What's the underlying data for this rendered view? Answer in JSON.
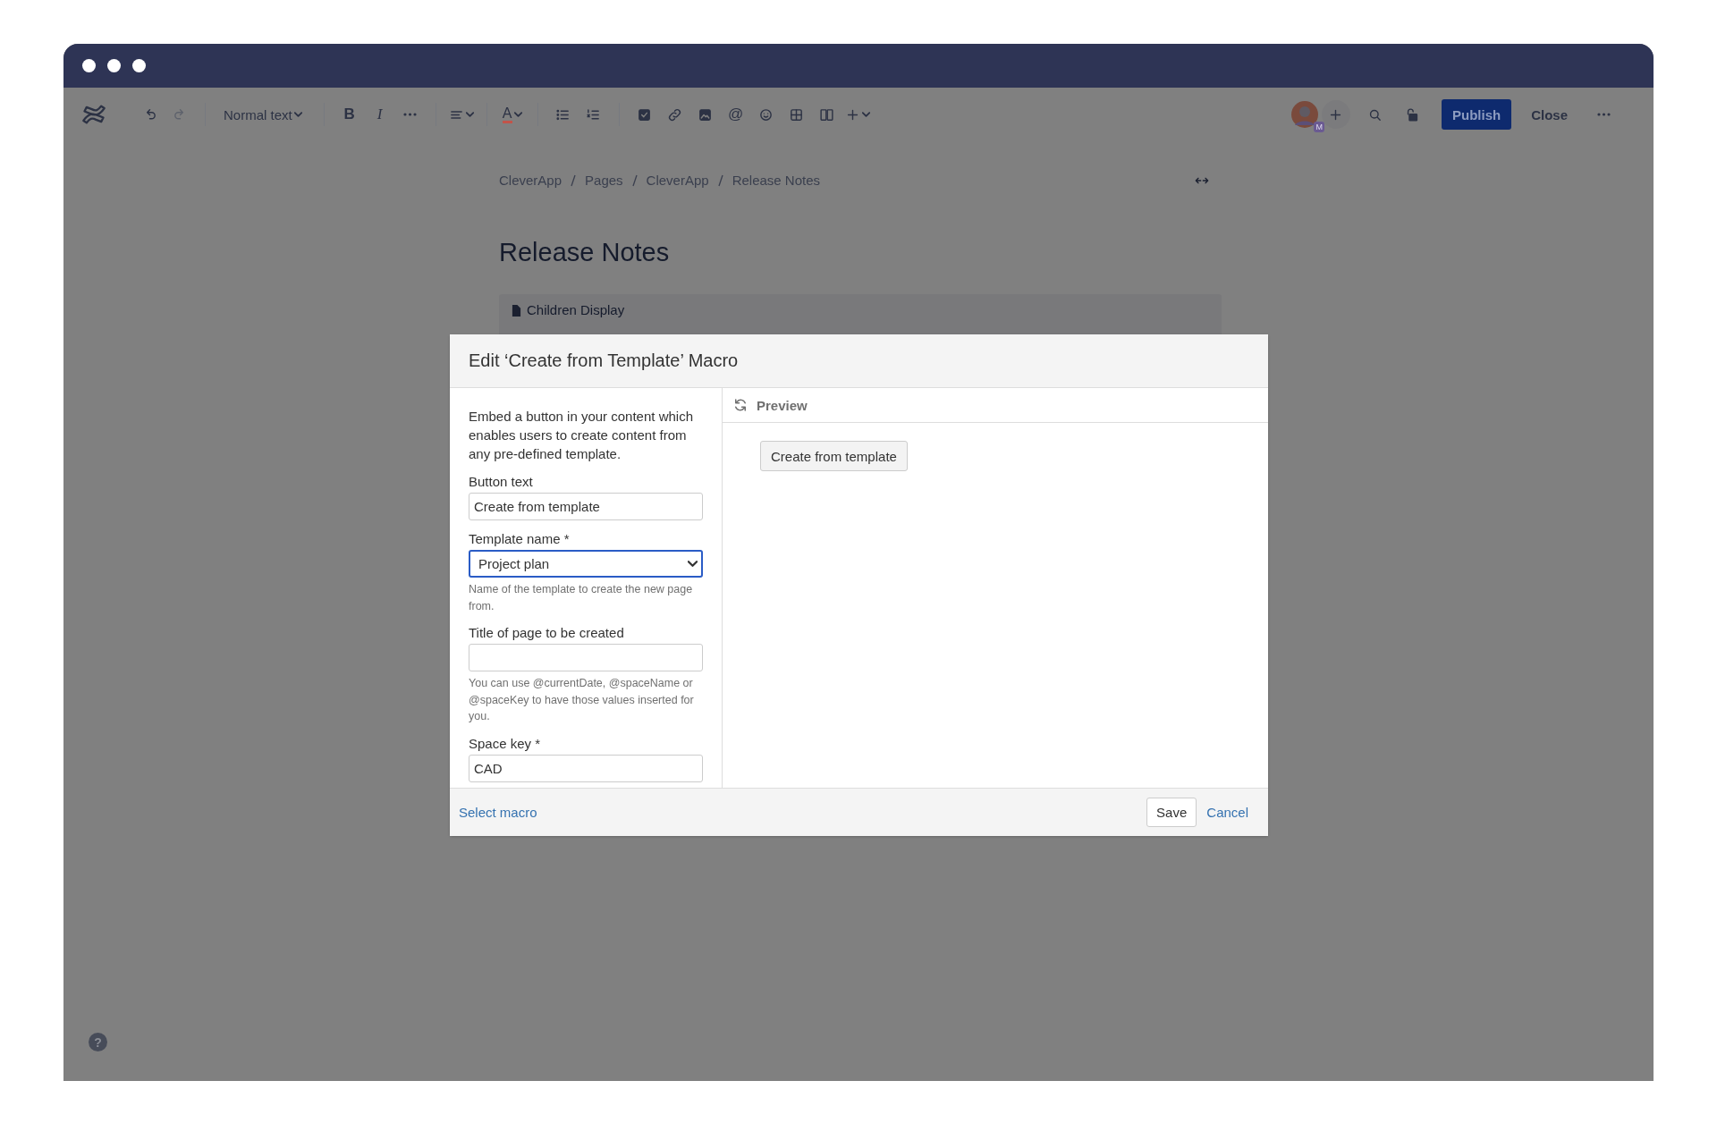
{
  "toolbar": {
    "left": [
      [
        {
          "kind": "logo"
        }
      ],
      [
        {
          "kind": "undo",
          "disabled": false
        },
        {
          "kind": "redo",
          "disabled": true
        }
      ],
      [
        {
          "kind": "dropdown",
          "text": "Normal text"
        }
      ],
      [
        {
          "kind": "bold",
          "text": "B"
        },
        {
          "kind": "italic",
          "text": "I"
        },
        {
          "kind": "more"
        }
      ],
      [
        {
          "kind": "align",
          "menu": true
        }
      ],
      [
        {
          "kind": "color",
          "text": "A",
          "menu": true
        }
      ],
      [
        {
          "kind": "bullets"
        },
        {
          "kind": "numbers"
        }
      ],
      [
        {
          "kind": "task"
        },
        {
          "kind": "link"
        },
        {
          "kind": "image"
        },
        {
          "kind": "glyph",
          "text": "@"
        },
        {
          "kind": "emoji"
        },
        {
          "kind": "table"
        },
        {
          "kind": "layout"
        },
        {
          "kind": "insert",
          "menu": true
        }
      ]
    ],
    "avatar_badge": "M",
    "publish": "Publish",
    "close": "Close"
  },
  "breadcrumbs": [
    "CleverApp",
    "Pages",
    "CleverApp",
    "Release Notes"
  ],
  "page_title": "Release Notes",
  "macro": {
    "name": "Children Display"
  },
  "dialog": {
    "title": "Edit ‘Create from Template’ Macro",
    "description": "Embed a button in your content which enables users to create content from any pre-defined template.",
    "fields": [
      {
        "kind": "text",
        "label": "Button text",
        "value": "Create from template"
      },
      {
        "kind": "select",
        "label": "Template name *",
        "value": "Project plan",
        "focused": true,
        "help": "Name of the template to create the new page from."
      },
      {
        "kind": "text",
        "label": "Title of page to be created",
        "help": "You can use @currentDate, @spaceName or @spaceKey to have those values inserted for you."
      },
      {
        "kind": "text",
        "label": "Space key *",
        "value": "CAD"
      }
    ],
    "preview": {
      "heading": "Preview",
      "button": "Create from template"
    },
    "select_macro": "Select macro",
    "save": "Save",
    "cancel": "Cancel"
  },
  "help": "?"
}
